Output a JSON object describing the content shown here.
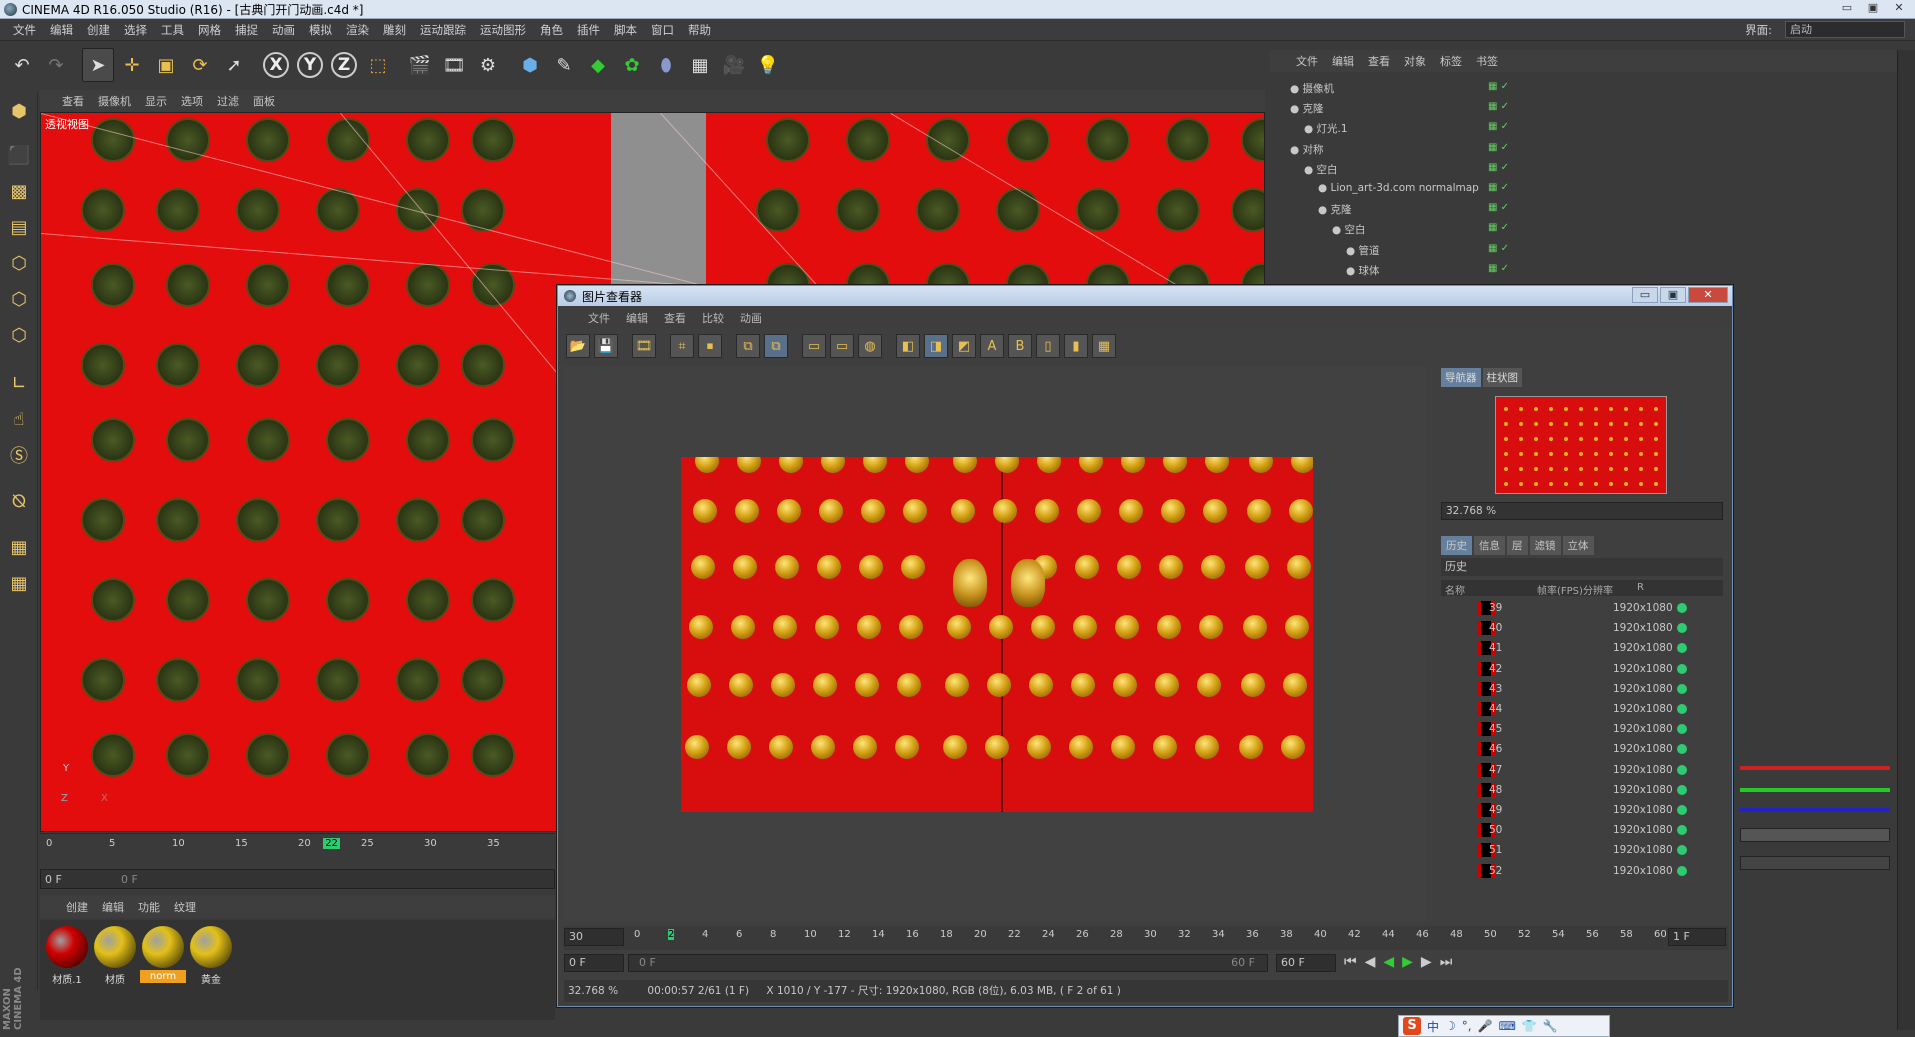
{
  "window": {
    "title": "CINEMA 4D R16.050 Studio (R16) - [古典门开门动画.c4d *]",
    "min": "▭",
    "max": "▣",
    "close": "✕"
  },
  "menu": [
    "文件",
    "编辑",
    "创建",
    "选择",
    "工具",
    "网格",
    "捕捉",
    "动画",
    "模拟",
    "渲染",
    "雕刻",
    "运动跟踪",
    "运动图形",
    "角色",
    "插件",
    "脚本",
    "窗口",
    "帮助"
  ],
  "layout": {
    "label": "界面:",
    "value": "启动"
  },
  "viewport": {
    "menu": [
      "查看",
      "摄像机",
      "显示",
      "选项",
      "过滤",
      "面板"
    ],
    "label": "透视视图",
    "axis_y": "Y",
    "axis_z": "Z",
    "axis_x": "X"
  },
  "timeline": {
    "ticks": [
      "0",
      "5",
      "10",
      "15",
      "20",
      "22",
      "25",
      "30",
      "35"
    ],
    "current": "22",
    "frame_field": "0 F",
    "frame_field2": "0 F"
  },
  "materials": {
    "menu": [
      "创建",
      "编辑",
      "功能",
      "纹理"
    ],
    "items": [
      {
        "label": "材质.1",
        "color": "#d00000"
      },
      {
        "label": "材质",
        "color": "#e3c018"
      },
      {
        "label": "norm",
        "color": "#e3c018"
      },
      {
        "label": "黄金",
        "color": "#e3c018"
      }
    ]
  },
  "brand": "MAXON CINEMA 4D",
  "objects": {
    "menu": [
      "文件",
      "编辑",
      "查看",
      "对象",
      "标签",
      "书签"
    ],
    "rows": [
      {
        "name": "摄像机",
        "indent": 0
      },
      {
        "name": "克隆",
        "indent": 0
      },
      {
        "name": "灯光.1",
        "indent": 1
      },
      {
        "name": "对称",
        "indent": 0
      },
      {
        "name": "空白",
        "indent": 1
      },
      {
        "name": "Lion_art-3d.com normalmap",
        "indent": 2
      },
      {
        "name": "克隆",
        "indent": 2
      },
      {
        "name": "空白",
        "indent": 3
      },
      {
        "name": "管道",
        "indent": 4
      },
      {
        "name": "球体",
        "indent": 4
      }
    ]
  },
  "viewer": {
    "title": "图片查看器",
    "menu": [
      "文件",
      "编辑",
      "查看",
      "比较",
      "动画"
    ],
    "nav_tabs": [
      "导航器",
      "柱状图"
    ],
    "zoom": "32.768 %",
    "hist_tabs": [
      "历史",
      "信息",
      "层",
      "滤镜",
      "立体"
    ],
    "hist_title": "历史",
    "cols": {
      "name": "名称",
      "fps": "帧率(FPS)",
      "res": "分辨率",
      "r": "R"
    },
    "rows": [
      {
        "n": "39",
        "res": "1920x1080"
      },
      {
        "n": "40",
        "res": "1920x1080"
      },
      {
        "n": "41",
        "res": "1920x1080"
      },
      {
        "n": "42",
        "res": "1920x1080"
      },
      {
        "n": "43",
        "res": "1920x1080"
      },
      {
        "n": "44",
        "res": "1920x1080"
      },
      {
        "n": "45",
        "res": "1920x1080"
      },
      {
        "n": "46",
        "res": "1920x1080"
      },
      {
        "n": "47",
        "res": "1920x1080"
      },
      {
        "n": "48",
        "res": "1920x1080"
      },
      {
        "n": "49",
        "res": "1920x1080"
      },
      {
        "n": "50",
        "res": "1920x1080"
      },
      {
        "n": "51",
        "res": "1920x1080"
      },
      {
        "n": "52",
        "res": "1920x1080"
      }
    ],
    "time_field": "30",
    "ticks": [
      "0",
      "2",
      "4",
      "6",
      "8",
      "10",
      "12",
      "14",
      "16",
      "18",
      "20",
      "22",
      "24",
      "26",
      "28",
      "30",
      "32",
      "34",
      "36",
      "38",
      "40",
      "42",
      "44",
      "46",
      "48",
      "50",
      "52",
      "54",
      "56",
      "58",
      "60"
    ],
    "end_field": "1 F",
    "row2_left": "0 F",
    "row2_mid_left": "0 F",
    "row2_mid_right": "60 F",
    "row2_right": "60 F",
    "status_zoom": "32.768 %",
    "status_time": "00:00:57 2/61 (1 F)",
    "status_info": "X 1010 / Y -177 - 尺寸: 1920x1080, RGB (8位), 6.03 MB,  ( F 2 of 61 )"
  },
  "ime": {
    "logo": "S",
    "lang": "中"
  }
}
